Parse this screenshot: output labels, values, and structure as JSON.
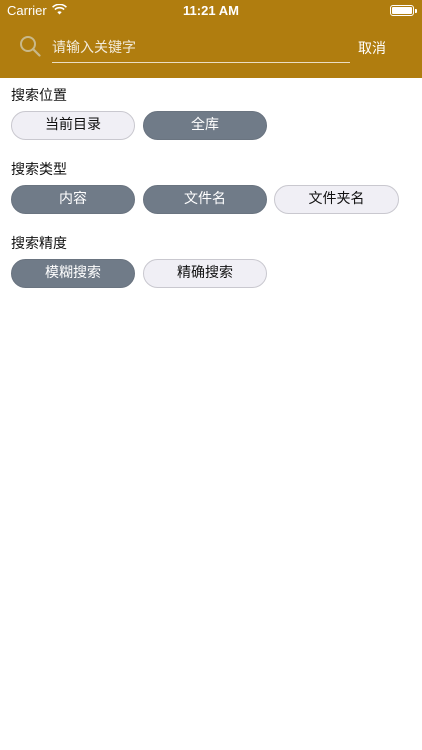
{
  "status_bar": {
    "carrier": "Carrier",
    "time": "11:21 AM"
  },
  "header": {
    "search_placeholder": "请输入关键字",
    "cancel_label": "取消",
    "background_color": "#b07d0f"
  },
  "sections": [
    {
      "title": "搜索位置",
      "options": [
        {
          "label": "当前目录",
          "selected": false
        },
        {
          "label": "全库",
          "selected": true
        }
      ]
    },
    {
      "title": "搜索类型",
      "options": [
        {
          "label": "内容",
          "selected": true
        },
        {
          "label": "文件名",
          "selected": true
        },
        {
          "label": "文件夹名",
          "selected": false
        }
      ]
    },
    {
      "title": "搜索精度",
      "options": [
        {
          "label": "模糊搜索",
          "selected": true
        },
        {
          "label": "精确搜索",
          "selected": false
        }
      ]
    }
  ],
  "colors": {
    "chip_selected": "#707b88",
    "chip_unselected": "#f0eff5"
  }
}
